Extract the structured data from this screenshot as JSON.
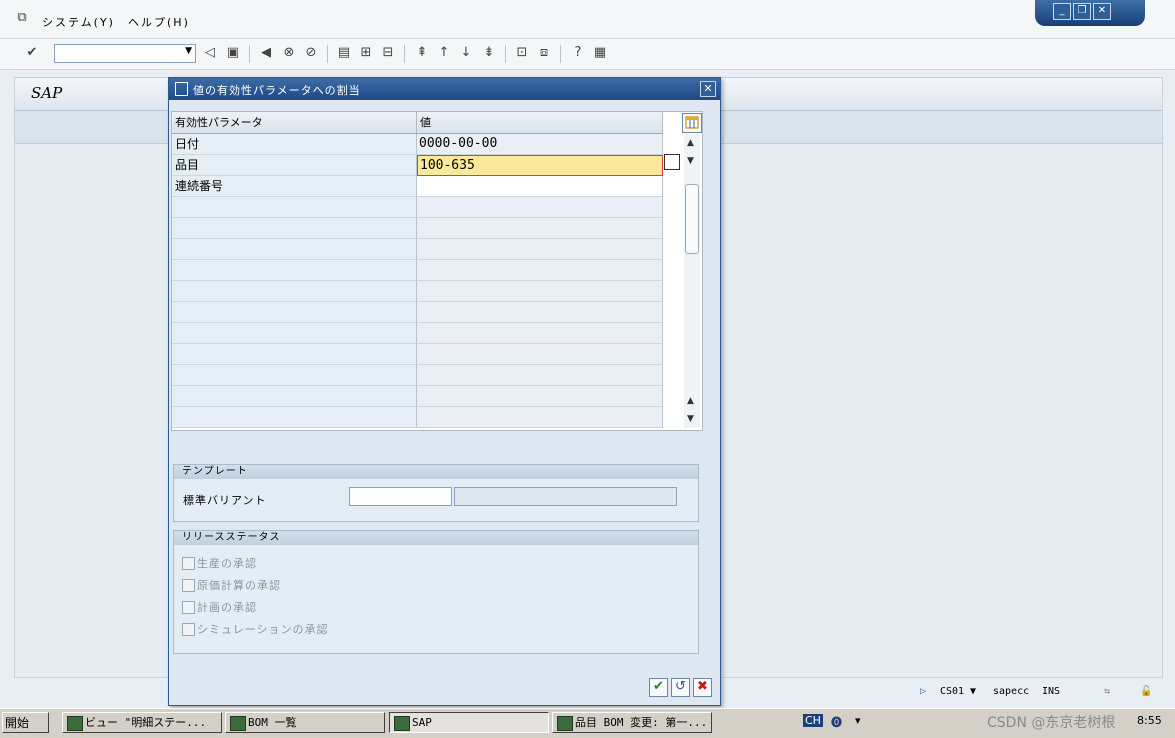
{
  "menu": {
    "system": "システム(Y)",
    "help": "ヘルプ(H)"
  },
  "window_controls": {
    "minimize": "_",
    "restore": "❐",
    "close": "✕"
  },
  "toolbar": {
    "command_field_value": ""
  },
  "screen": {
    "title": "SAP"
  },
  "dialog": {
    "title": "値の有効性パラメータへの割当",
    "close": "✕",
    "table": {
      "headers": [
        "有効性パラメータ",
        "値"
      ],
      "rows": [
        {
          "param": "日付",
          "value": "0000-00-00"
        },
        {
          "param": "品目",
          "value": "100-635"
        },
        {
          "param": "連続番号",
          "value": ""
        }
      ]
    },
    "template_group": {
      "title": "テンプレート",
      "label": "標準バリアント",
      "input_value": ""
    },
    "release_group": {
      "title": "リリースステータス",
      "items": [
        "生産の承認",
        "原価計算の承認",
        "計画の承認",
        "シミュレーションの承認"
      ]
    },
    "buttons": {
      "ok": "✔",
      "save": "↺",
      "cancel": "✖"
    }
  },
  "statusbar": {
    "transaction": "CS01",
    "server": "sapecc",
    "mode": "INS"
  },
  "taskbar": {
    "start": "開始",
    "tasks": [
      "ビュー \"明細ステー...",
      "BOM 一覧",
      "SAP",
      "品目 BOM 変更: 第一..."
    ],
    "tray": {
      "lang": "CH",
      "time": "8:55"
    }
  },
  "watermark": "CSDN @东京老树根"
}
